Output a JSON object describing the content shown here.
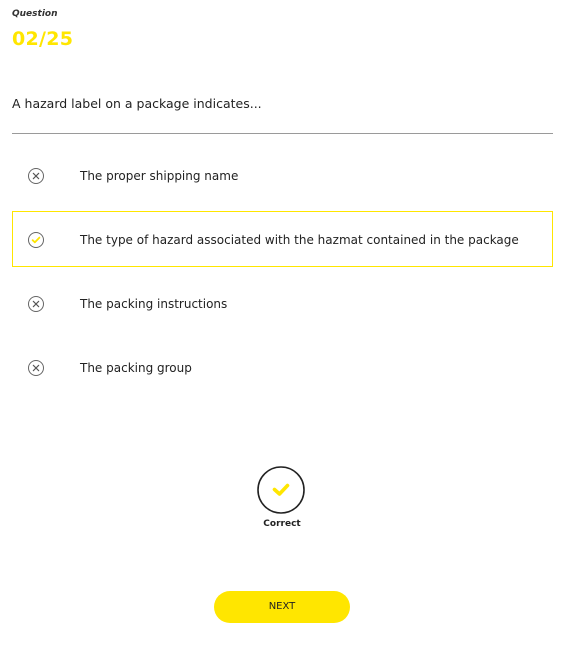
{
  "header": {
    "label": "Question",
    "number": "02/25"
  },
  "question": {
    "text": "A hazard label on a package indicates..."
  },
  "options": [
    {
      "text": "The proper shipping name",
      "icon": "x-circle-icon",
      "state": "incorrect"
    },
    {
      "text": "The type of hazard associated with the hazmat contained in the package",
      "icon": "check-circle-icon",
      "state": "selected-correct"
    },
    {
      "text": "The packing instructions",
      "icon": "x-circle-icon",
      "state": "incorrect"
    },
    {
      "text": "The packing group",
      "icon": "x-circle-icon",
      "state": "incorrect"
    }
  ],
  "result": {
    "label": "Correct",
    "icon": "check-icon"
  },
  "next": {
    "label": "NEXT"
  },
  "colors": {
    "accent": "#FFE600",
    "text": "#222222",
    "divider": "#9a9a9a"
  }
}
